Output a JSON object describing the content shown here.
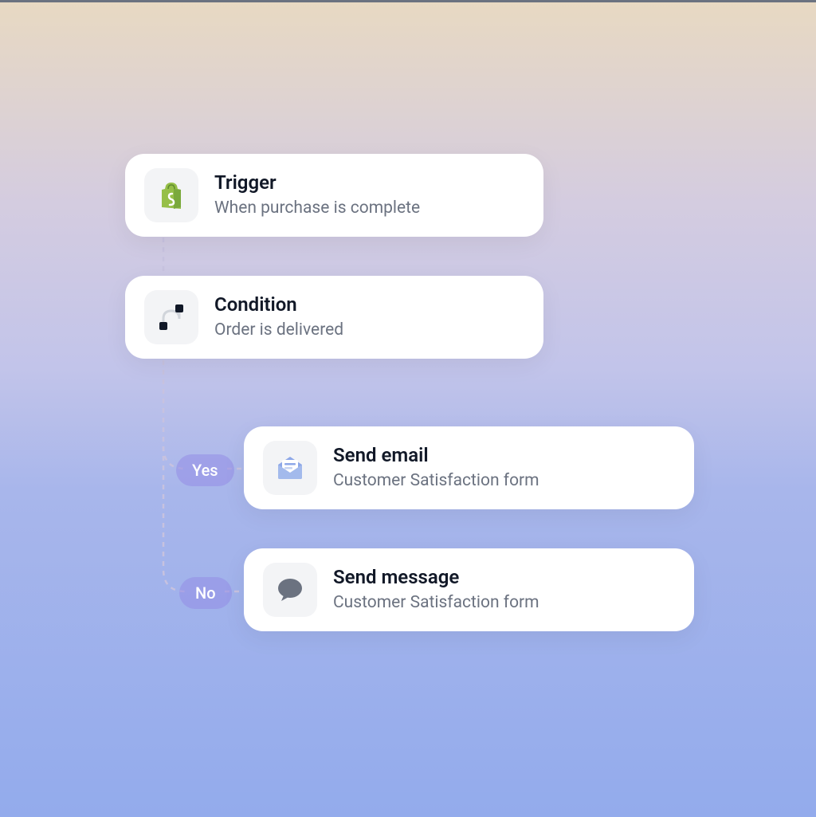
{
  "workflow": {
    "nodes": [
      {
        "id": "trigger",
        "icon": "shopify-icon",
        "title": "Trigger",
        "subtitle": "When purchase is complete"
      },
      {
        "id": "condition",
        "icon": "branch-icon",
        "title": "Condition",
        "subtitle": "Order is delivered"
      },
      {
        "id": "send_email",
        "icon": "email-icon",
        "title": "Send email",
        "subtitle": "Customer Satisfaction form"
      },
      {
        "id": "send_message",
        "icon": "message-icon",
        "title": "Send message",
        "subtitle": "Customer Satisfaction form"
      }
    ],
    "branches": {
      "yes_label": "Yes",
      "no_label": "No"
    },
    "colors": {
      "card_bg": "#ffffff",
      "icon_bg": "#f3f4f6",
      "title": "#111827",
      "subtitle": "#6b7280",
      "shopify_green": "#96bf48",
      "email_blue": "#8ea8e8",
      "message_gray": "#6b7280",
      "pill_bg": "rgba(148,140,230,0.55)",
      "connector": "#c7c2df"
    }
  }
}
